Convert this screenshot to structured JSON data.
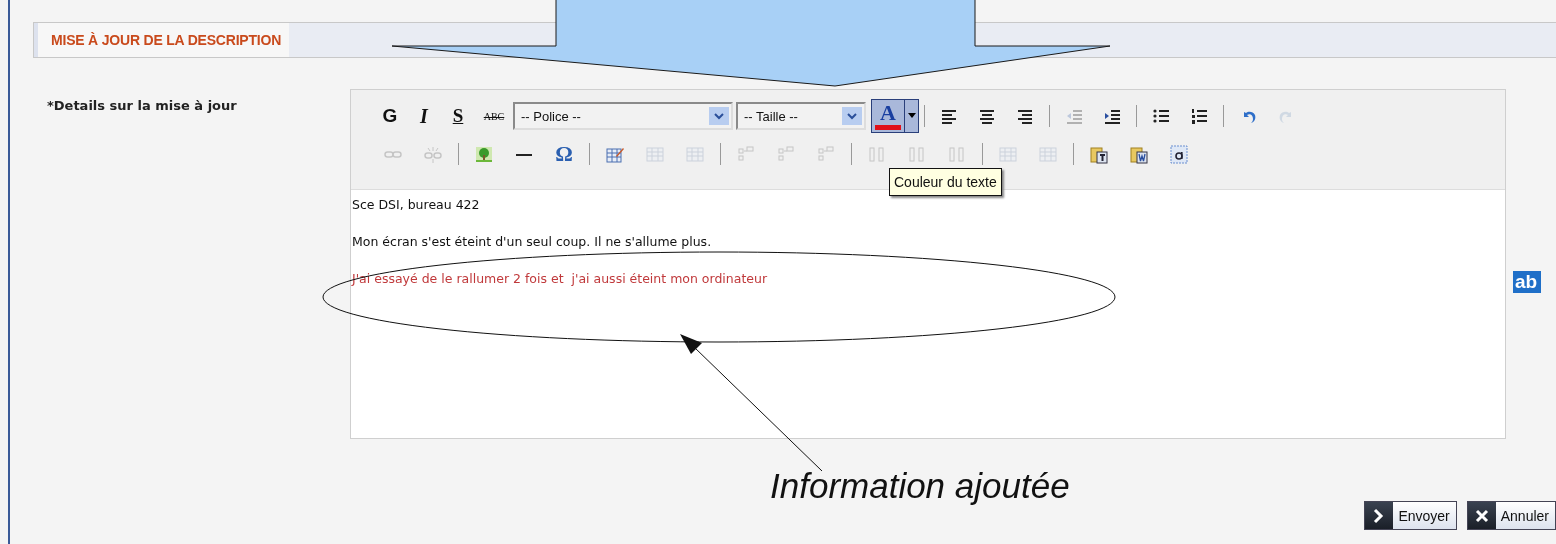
{
  "section_header": {
    "title": "MISE À JOUR DE LA DESCRIPTION"
  },
  "field": {
    "label": "*Details sur la mise à jour"
  },
  "toolbar": [
    {
      "items": [
        {
          "kind": "bold",
          "label": "G",
          "disabled": false
        },
        {
          "kind": "italic",
          "label": "I",
          "disabled": false
        },
        {
          "kind": "underline",
          "label": "S",
          "disabled": false
        },
        {
          "kind": "strike",
          "label": "ABC",
          "disabled": false
        },
        {
          "kind": "select",
          "label": "-- Police --"
        },
        {
          "kind": "select",
          "label": "-- Taille --"
        },
        {
          "kind": "color",
          "label": "A",
          "active": true,
          "color": "#e0101a"
        },
        {
          "kind": "sep"
        },
        {
          "kind": "alignleft",
          "disabled": false
        },
        {
          "kind": "aligncenter",
          "disabled": false
        },
        {
          "kind": "alignright",
          "disabled": false
        },
        {
          "kind": "sep"
        },
        {
          "kind": "outdent",
          "disabled": true
        },
        {
          "kind": "indent",
          "disabled": false
        },
        {
          "kind": "sep"
        },
        {
          "kind": "bullets",
          "disabled": false
        },
        {
          "kind": "numbers",
          "disabled": false
        },
        {
          "kind": "sep"
        },
        {
          "kind": "undo",
          "disabled": false
        },
        {
          "kind": "redo",
          "disabled": true
        }
      ]
    },
    {
      "items": [
        {
          "kind": "link",
          "disabled": true
        },
        {
          "kind": "unlink",
          "disabled": true
        },
        {
          "kind": "sep"
        },
        {
          "kind": "image",
          "disabled": false
        },
        {
          "kind": "rule",
          "disabled": false
        },
        {
          "kind": "symbol",
          "label": "Ω",
          "disabled": false
        },
        {
          "kind": "sep"
        },
        {
          "kind": "tableedit",
          "disabled": false
        },
        {
          "kind": "table",
          "disabled": true
        },
        {
          "kind": "table",
          "disabled": true
        },
        {
          "kind": "sep"
        },
        {
          "kind": "rows",
          "disabled": true
        },
        {
          "kind": "rows",
          "disabled": true
        },
        {
          "kind": "rows",
          "disabled": true
        },
        {
          "kind": "sep"
        },
        {
          "kind": "cols",
          "disabled": true
        },
        {
          "kind": "cols",
          "disabled": true
        },
        {
          "kind": "cols",
          "disabled": true
        },
        {
          "kind": "sep"
        },
        {
          "kind": "table",
          "disabled": true
        },
        {
          "kind": "table",
          "disabled": true
        },
        {
          "kind": "sep"
        },
        {
          "kind": "pastetext",
          "disabled": false
        },
        {
          "kind": "pasteword",
          "disabled": false
        },
        {
          "kind": "selectall",
          "disabled": false
        }
      ]
    }
  ],
  "tooltip": {
    "text": "Couleur du texte"
  },
  "editor": {
    "lines": [
      {
        "text": "Sce DSI, bureau 422",
        "color": "#111111"
      },
      {
        "text": "Mon écran s'est éteint d'un seul coup. Il ne s'allume plus.",
        "color": "#111111"
      },
      {
        "text": "J'ai essayé de le rallumer 2 fois et  j'ai aussi éteint mon ordinateur",
        "color": "#c0393b"
      }
    ]
  },
  "side_logo": {
    "text": "ab"
  },
  "buttons": [
    {
      "kind": "submit",
      "label": "Envoyer"
    },
    {
      "kind": "cancel",
      "label": "Annuler"
    }
  ],
  "annotation": {
    "text": "Information ajoutée"
  }
}
